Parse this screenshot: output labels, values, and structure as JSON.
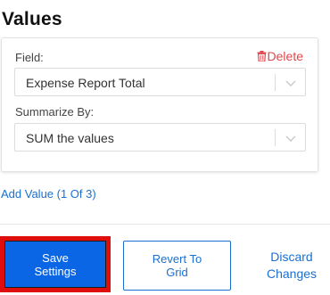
{
  "section": {
    "title": "Values"
  },
  "value_card": {
    "field_label": "Field:",
    "delete_label": "Delete",
    "field_value": "Expense Report Total",
    "summarize_label": "Summarize By:",
    "summarize_value": "SUM the values"
  },
  "add_value_label": "Add Value (1 Of 3)",
  "actions": {
    "save_label": "Save Settings",
    "revert_label": "Revert To Grid",
    "discard_label": "Discard Changes"
  },
  "colors": {
    "accent": "#1a6fd1",
    "primary_button": "#0a66e4",
    "delete": "#e0474c",
    "highlight": "#e00d0d"
  },
  "icons": {
    "delete": "trash-icon",
    "dropdown": "chevron-down-icon"
  }
}
